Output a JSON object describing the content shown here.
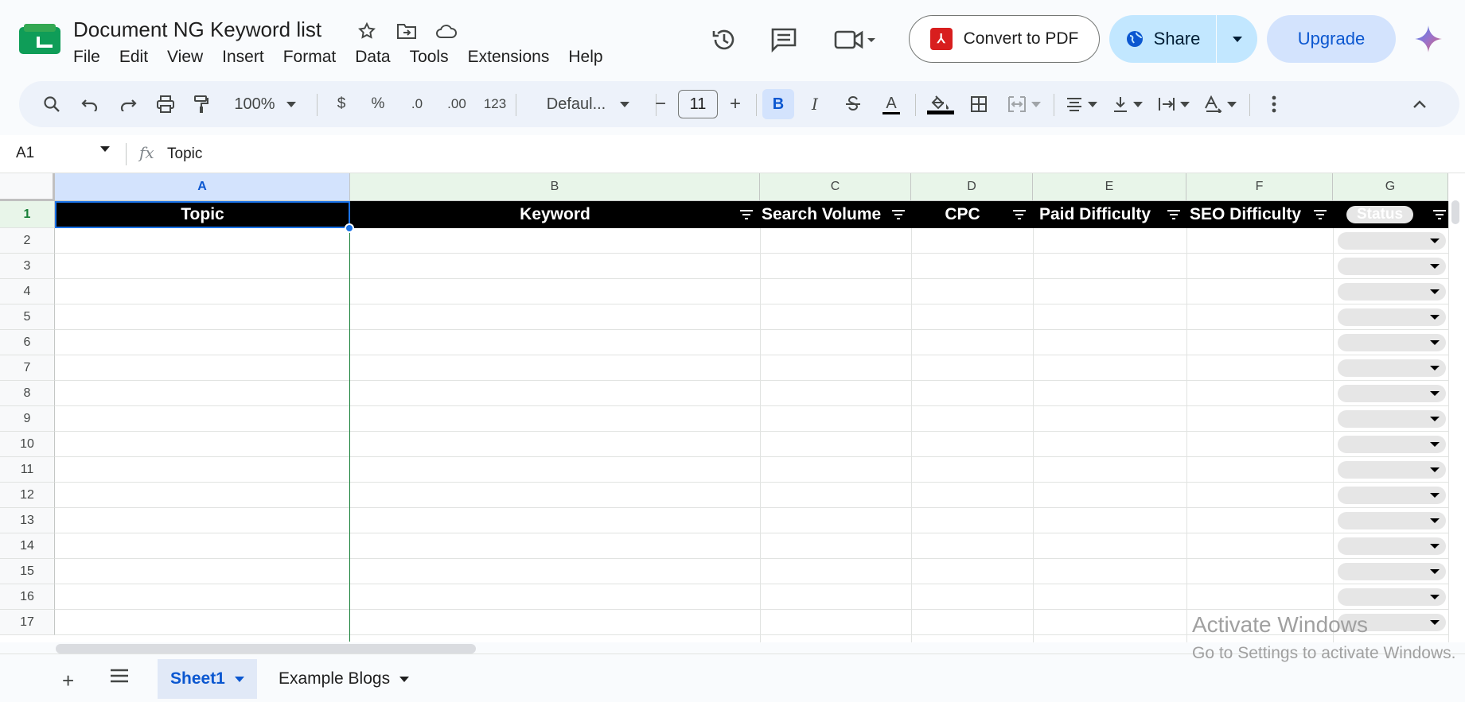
{
  "app": {
    "doc_title": "Document NG Keyword list",
    "menus": [
      "File",
      "Edit",
      "View",
      "Insert",
      "Format",
      "Data",
      "Tools",
      "Extensions",
      "Help"
    ],
    "convert_label": "Convert to PDF",
    "share_label": "Share",
    "upgrade_label": "Upgrade"
  },
  "toolbar": {
    "zoom": "100%",
    "currency": "$",
    "percent": "%",
    "dec_decrease": ".0",
    "dec_increase": ".00",
    "number_format": "123",
    "font": "Defaul...",
    "font_size": "11",
    "bold": "B",
    "italic": "I",
    "text_color_letter": "A"
  },
  "formula_bar": {
    "cell_ref": "A1",
    "fx": "fx",
    "value": "Topic"
  },
  "columns": [
    "A",
    "B",
    "C",
    "D",
    "E",
    "F",
    "G"
  ],
  "rows": [
    "1",
    "2",
    "3",
    "4",
    "5",
    "6",
    "7",
    "8",
    "9",
    "10",
    "11",
    "12",
    "13",
    "14",
    "15",
    "16",
    "17"
  ],
  "header_cells": {
    "topic": "Topic",
    "keyword": "Keyword",
    "search_volume": "Search Volume",
    "cpc": "CPC",
    "paid_difficulty": "Paid Difficulty",
    "seo_difficulty": "SEO Difficulty",
    "status": "Status"
  },
  "tabs": {
    "sheet1": "Sheet1",
    "example_blogs": "Example Blogs"
  },
  "watermark": {
    "line1": "Activate Windows",
    "line2": "Go to Settings to activate Windows."
  },
  "colors": {
    "accent": "#0b57d0",
    "header_fill": "#000000",
    "share_bg": "#c2e7ff",
    "upgrade_bg": "#d3e3fd"
  }
}
